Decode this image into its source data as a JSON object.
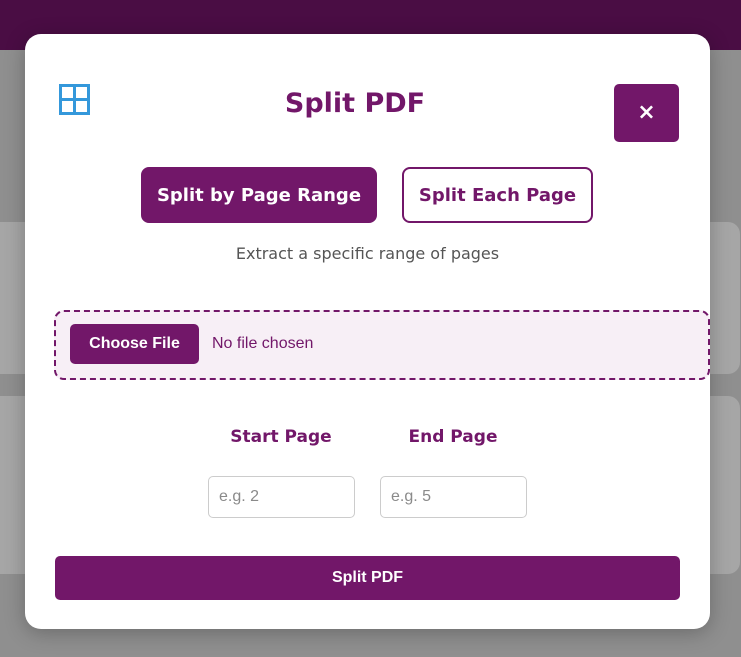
{
  "modal": {
    "title": "Split PDF",
    "close_label": "×",
    "icon": "grid-icon",
    "modes": [
      {
        "label": "Split by Page Range",
        "active": true
      },
      {
        "label": "Split Each Page",
        "active": false
      }
    ],
    "description": "Extract a specific range of pages",
    "file_input": {
      "button_label": "Choose File",
      "status": "No file chosen"
    },
    "start_page": {
      "label": "Start Page",
      "placeholder": "e.g. 2",
      "value": ""
    },
    "end_page": {
      "label": "End Page",
      "placeholder": "e.g. 5",
      "value": ""
    },
    "submit_label": "Split PDF"
  },
  "colors": {
    "accent": "#721769",
    "topbar": "#4a0d44",
    "icon": "#3498db",
    "dropzone_bg": "#f7eff6",
    "overlay": "#8f8f8f"
  }
}
